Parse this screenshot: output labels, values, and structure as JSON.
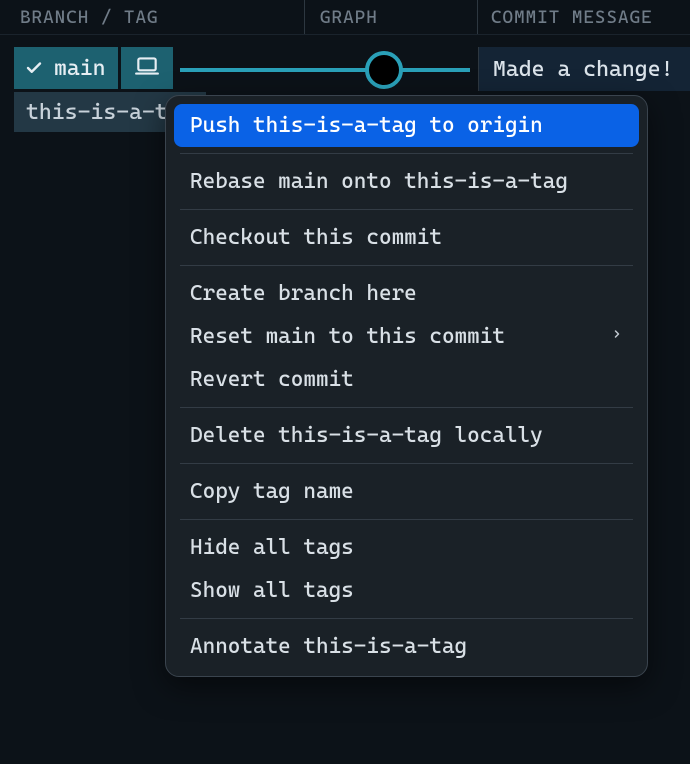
{
  "columns": {
    "branch": "BRANCH / TAG",
    "graph": "GRAPH",
    "message": "COMMIT MESSAGE"
  },
  "refs": {
    "branch_name": "main",
    "tag_name": "this-is-a-tag"
  },
  "commit": {
    "message": "Made a change!"
  },
  "context_menu": {
    "groups": [
      [
        {
          "label": "Push this-is-a-tag to origin",
          "highlighted": true,
          "submenu": false
        }
      ],
      [
        {
          "label": "Rebase main onto this-is-a-tag",
          "highlighted": false,
          "submenu": false
        }
      ],
      [
        {
          "label": "Checkout this commit",
          "highlighted": false,
          "submenu": false
        }
      ],
      [
        {
          "label": "Create branch here",
          "highlighted": false,
          "submenu": false
        },
        {
          "label": "Reset main to this commit",
          "highlighted": false,
          "submenu": true
        },
        {
          "label": "Revert commit",
          "highlighted": false,
          "submenu": false
        }
      ],
      [
        {
          "label": "Delete this-is-a-tag locally",
          "highlighted": false,
          "submenu": false
        }
      ],
      [
        {
          "label": "Copy tag name",
          "highlighted": false,
          "submenu": false
        }
      ],
      [
        {
          "label": "Hide all tags",
          "highlighted": false,
          "submenu": false
        },
        {
          "label": "Show all tags",
          "highlighted": false,
          "submenu": false
        }
      ],
      [
        {
          "label": "Annotate this-is-a-tag",
          "highlighted": false,
          "submenu": false
        }
      ]
    ]
  }
}
